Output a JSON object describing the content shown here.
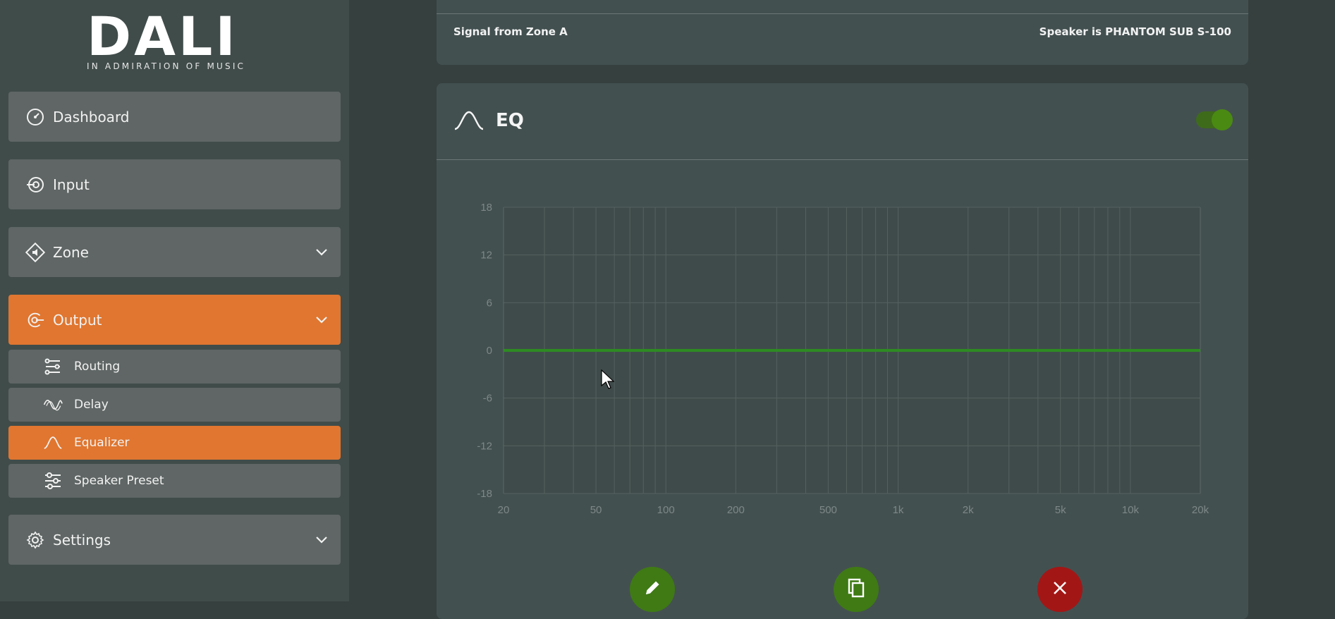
{
  "brand": {
    "logo": "DALI",
    "tagline": "IN ADMIRATION OF MUSIC"
  },
  "nav": {
    "dashboard": {
      "label": "Dashboard",
      "icon": "dashboard-gauge-icon"
    },
    "input": {
      "label": "Input",
      "icon": "input-icon"
    },
    "zone": {
      "label": "Zone",
      "icon": "zone-speaker-icon"
    },
    "output": {
      "label": "Output",
      "icon": "output-icon",
      "active": true
    },
    "routing": {
      "label": "Routing",
      "icon": "routing-icon"
    },
    "delay": {
      "label": "Delay",
      "icon": "delay-wave-icon"
    },
    "equalizer": {
      "label": "Equalizer",
      "icon": "bell-curve-icon",
      "active": true
    },
    "speaker_preset": {
      "label": "Speaker Preset",
      "icon": "sliders-icon"
    },
    "settings": {
      "label": "Settings",
      "icon": "gear-icon"
    }
  },
  "signal": {
    "left": "Signal from Zone A",
    "right": "Speaker is PHANTOM SUB S-100"
  },
  "eq": {
    "title": "EQ",
    "enabled": true,
    "actions": [
      "edit-pencil-icon",
      "copy-icon",
      "delete-x-icon"
    ]
  },
  "colors": {
    "accent": "#e07630",
    "eq_line": "#2e8b22",
    "toggle_on": "#4a8a12",
    "delete": "#a31616"
  },
  "chart_data": {
    "type": "line",
    "x_scale": "log",
    "xlim": [
      20,
      20000
    ],
    "ylim": [
      -18,
      18
    ],
    "x_ticks": [
      20,
      50,
      100,
      200,
      500,
      1000,
      2000,
      5000,
      10000,
      20000
    ],
    "x_tick_labels": [
      "20",
      "50",
      "100",
      "200",
      "500",
      "1k",
      "2k",
      "5k",
      "10k",
      "20k"
    ],
    "y_ticks": [
      18,
      12,
      6,
      0,
      -6,
      -12,
      -18
    ],
    "y_tick_labels": [
      "18",
      "12",
      "6",
      "0",
      "-6",
      "-12",
      "-18"
    ],
    "grid": true,
    "series": [
      {
        "x": [
          20,
          20000
        ],
        "y": [
          0,
          0
        ],
        "color": "#2e8b22"
      }
    ]
  }
}
